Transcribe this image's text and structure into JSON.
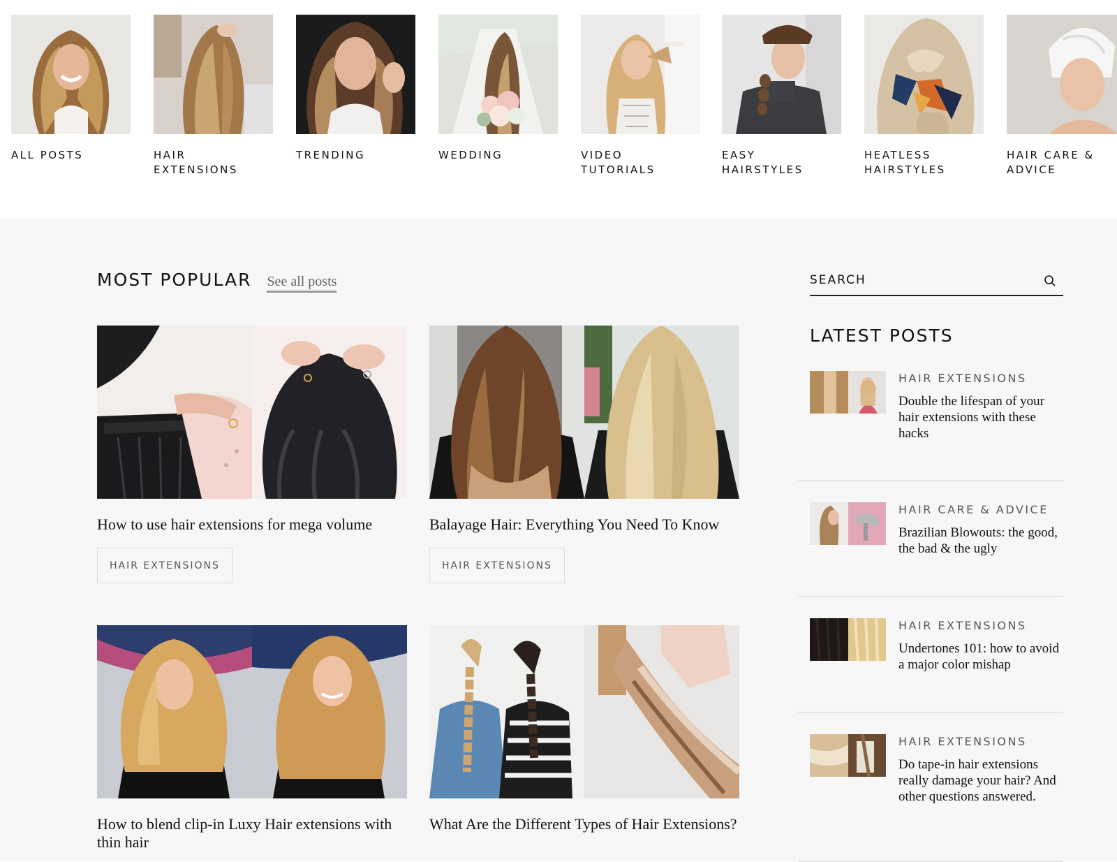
{
  "categories": [
    {
      "label": "ALL POSTS",
      "icon": "photo-woman-wavy-blonde"
    },
    {
      "label": "HAIR EXTENSIONS",
      "icon": "photo-hair-extensions-back"
    },
    {
      "label": "TRENDING",
      "icon": "photo-woman-balayage"
    },
    {
      "label": "WEDDING",
      "icon": "photo-bride-bouquet"
    },
    {
      "label": "VIDEO TUTORIALS",
      "icon": "photo-woman-curling"
    },
    {
      "label": "EASY HAIRSTYLES",
      "icon": "photo-woman-braid-cap"
    },
    {
      "label": "HEATLESS HAIRSTYLES",
      "icon": "photo-scarf-ponytail"
    },
    {
      "label": "HAIR CARE & ADVICE",
      "icon": "photo-towel-turban"
    }
  ],
  "most_popular": {
    "title": "MOST POPULAR",
    "see_all": "See all posts",
    "posts": [
      {
        "title": "How to use hair extensions for mega volume",
        "tag": "HAIR EXTENSIONS"
      },
      {
        "title": "Balayage Hair: Everything You Need To Know",
        "tag": "HAIR EXTENSIONS"
      },
      {
        "title": "How to blend clip-in Luxy Hair extensions with thin hair",
        "tag": ""
      },
      {
        "title": "What Are the Different Types of Hair Extensions?",
        "tag": ""
      }
    ]
  },
  "sidebar": {
    "search_placeholder": "SEARCH",
    "latest_title": "LATEST POSTS",
    "latest": [
      {
        "category": "HAIR EXTENSIONS",
        "title": "Double the lifespan of your hair extensions with these hacks"
      },
      {
        "category": "HAIR CARE & ADVICE",
        "title": "Brazilian Blowouts: the good, the bad & the ugly"
      },
      {
        "category": "HAIR EXTENSIONS",
        "title": "Undertones 101: how to avoid a major color mishap"
      },
      {
        "category": "HAIR EXTENSIONS",
        "title": "Do tape-in hair extensions really damage your hair? And other questions answered."
      }
    ]
  },
  "colors": {
    "page_bg": "#f7f7f7",
    "header_bg": "#ffffff",
    "text": "#111111",
    "muted": "#555555",
    "divider": "#e6e6e6"
  }
}
